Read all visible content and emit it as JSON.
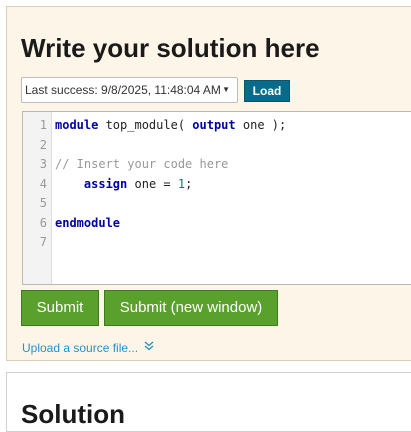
{
  "solution_panel": {
    "title": "Write your solution here",
    "history_dropdown": {
      "selected": "Last success: 9/8/2025, 11:48:04 AM"
    },
    "load_label": "Load",
    "editor": {
      "lines": [
        {
          "num": "1",
          "tokens": [
            {
              "t": "module",
              "k": "kw"
            },
            {
              "t": " top_module( ",
              "k": ""
            },
            {
              "t": "output",
              "k": "kw"
            },
            {
              "t": " one );",
              "k": ""
            }
          ]
        },
        {
          "num": "2",
          "tokens": []
        },
        {
          "num": "3",
          "tokens": [
            {
              "t": "// Insert your code here",
              "k": "cm"
            }
          ]
        },
        {
          "num": "4",
          "tokens": [
            {
              "t": "    ",
              "k": ""
            },
            {
              "t": "assign",
              "k": "kw"
            },
            {
              "t": " one = ",
              "k": ""
            },
            {
              "t": "1",
              "k": "num"
            },
            {
              "t": ";",
              "k": ""
            }
          ]
        },
        {
          "num": "5",
          "tokens": []
        },
        {
          "num": "6",
          "tokens": [
            {
              "t": "endmodule",
              "k": "kw"
            }
          ]
        },
        {
          "num": "7",
          "tokens": []
        }
      ]
    },
    "submit_label": "Submit",
    "submit_new_window_label": "Submit (new window)",
    "upload_label": "Upload a source file...",
    "upload_icon": "double-chevron-down-icon"
  },
  "solution_section": {
    "title": "Solution"
  },
  "colors": {
    "panel_bg": "#fdf6e8",
    "load_button": "#0a6a8a",
    "submit_button": "#5aa02c",
    "keyword": "#0000a8",
    "comment": "#999999",
    "link": "#2a8fc7"
  }
}
